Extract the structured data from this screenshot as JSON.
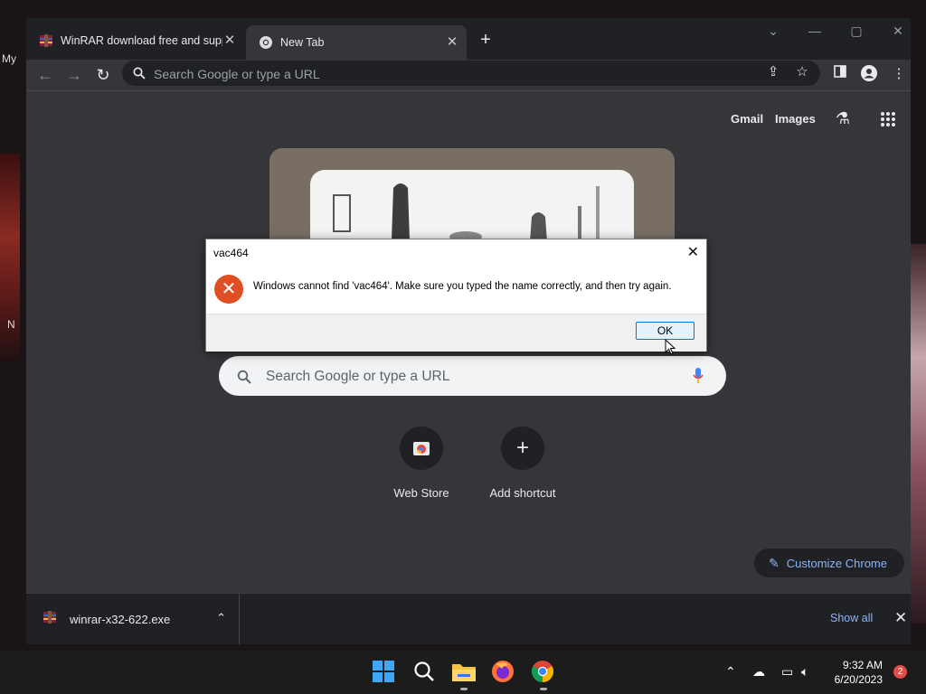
{
  "desktop": {
    "icon_label_top": "My",
    "icon_label_mid": "N"
  },
  "browser": {
    "tabs": [
      {
        "title": "WinRAR download free and supp",
        "favicon": "winrar-icon",
        "active": false
      },
      {
        "title": "New Tab",
        "favicon": "chrome-icon",
        "active": true
      }
    ],
    "omnibox": {
      "placeholder": "Search Google or type a URL"
    }
  },
  "ntp": {
    "links": {
      "gmail": "Gmail",
      "images": "Images"
    },
    "search": {
      "placeholder": "Search Google or type a URL"
    },
    "shortcuts": [
      {
        "label": "Web Store",
        "icon": "web-store-icon"
      },
      {
        "label": "Add shortcut",
        "icon": "plus-icon"
      }
    ],
    "customize_label": "Customize Chrome"
  },
  "downloads": {
    "file_name": "winrar-x32-622.exe",
    "show_all": "Show all"
  },
  "dialog": {
    "title": "vac464",
    "message": "Windows cannot find 'vac464'. Make sure you typed the name correctly, and then try again.",
    "ok_label": "OK",
    "icon": "error-icon"
  },
  "taskbar": {
    "time": "9:32 AM",
    "date": "6/20/2023",
    "notification_count": "2"
  },
  "colors": {
    "accent_blue": "#8ab4f8",
    "error_red": "#e04e24",
    "browser_bg": "#35363a"
  }
}
